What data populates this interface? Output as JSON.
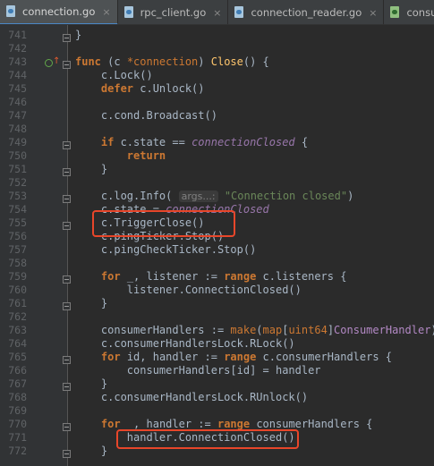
{
  "tabs": [
    {
      "label": "connection.go",
      "active": true,
      "icon": "go-file-icon"
    },
    {
      "label": "rpc_client.go",
      "active": false,
      "icon": "go-file-icon"
    },
    {
      "label": "connection_reader.go",
      "active": false,
      "icon": "go-file-icon"
    },
    {
      "label": "consum",
      "active": false,
      "icon": "go-file-icon"
    }
  ],
  "close_glyph": "×",
  "lines": [
    {
      "n": "741",
      "code": [
        {
          "t": "}"
        }
      ]
    },
    {
      "n": "742",
      "code": []
    },
    {
      "n": "743",
      "code": [
        {
          "t": "func",
          "c": "kw"
        },
        {
          "t": " (c "
        },
        {
          "t": "*connection",
          "c": "kwn"
        },
        {
          "t": ") "
        },
        {
          "t": "Close",
          "c": "fn"
        },
        {
          "t": "() {"
        }
      ]
    },
    {
      "n": "744",
      "code": [
        {
          "t": "    c.Lock()"
        }
      ]
    },
    {
      "n": "745",
      "code": [
        {
          "t": "    "
        },
        {
          "t": "defer",
          "c": "kw"
        },
        {
          "t": " c.Unlock()"
        }
      ]
    },
    {
      "n": "746",
      "code": []
    },
    {
      "n": "747",
      "code": [
        {
          "t": "    c.cond.Broadcast()"
        }
      ]
    },
    {
      "n": "748",
      "code": []
    },
    {
      "n": "749",
      "code": [
        {
          "t": "    "
        },
        {
          "t": "if",
          "c": "kw"
        },
        {
          "t": " c.state == "
        },
        {
          "t": "connectionClosed",
          "c": "it"
        },
        {
          "t": " {"
        }
      ]
    },
    {
      "n": "750",
      "code": [
        {
          "t": "        "
        },
        {
          "t": "return",
          "c": "kw"
        }
      ]
    },
    {
      "n": "751",
      "code": [
        {
          "t": "    }"
        }
      ]
    },
    {
      "n": "752",
      "code": []
    },
    {
      "n": "753",
      "code": [
        {
          "t": "    c.log.Info( "
        },
        {
          "t": "args...:",
          "c": "hint"
        },
        {
          "t": " "
        },
        {
          "t": "\"Connection closed\"",
          "c": "str"
        },
        {
          "t": ")"
        }
      ]
    },
    {
      "n": "754",
      "code": [
        {
          "t": "    c.state = "
        },
        {
          "t": "connectionClosed",
          "c": "it"
        }
      ]
    },
    {
      "n": "755",
      "code": [
        {
          "t": "    c.TriggerClose()"
        }
      ]
    },
    {
      "n": "756",
      "code": [
        {
          "t": "    c.pingTicker.Stop()"
        }
      ]
    },
    {
      "n": "757",
      "code": [
        {
          "t": "    c.pingCheckTicker.Stop()"
        }
      ]
    },
    {
      "n": "758",
      "code": []
    },
    {
      "n": "759",
      "code": [
        {
          "t": "    "
        },
        {
          "t": "for",
          "c": "kw"
        },
        {
          "t": " _, listener := "
        },
        {
          "t": "range",
          "c": "kw"
        },
        {
          "t": " c.listeners {"
        }
      ]
    },
    {
      "n": "760",
      "code": [
        {
          "t": "        listener.ConnectionClosed()"
        }
      ]
    },
    {
      "n": "761",
      "code": [
        {
          "t": "    }"
        }
      ]
    },
    {
      "n": "762",
      "code": []
    },
    {
      "n": "763",
      "code": [
        {
          "t": "    consumerHandlers := "
        },
        {
          "t": "make",
          "c": "kwn"
        },
        {
          "t": "("
        },
        {
          "t": "map",
          "c": "kwn"
        },
        {
          "t": "["
        },
        {
          "t": "uint64",
          "c": "kwn"
        },
        {
          "t": "]"
        },
        {
          "t": "ConsumerHandler",
          "c": "ty"
        },
        {
          "t": ")"
        }
      ]
    },
    {
      "n": "764",
      "code": [
        {
          "t": "    c.consumerHandlersLock.RLock()"
        }
      ]
    },
    {
      "n": "765",
      "code": [
        {
          "t": "    "
        },
        {
          "t": "for",
          "c": "kw"
        },
        {
          "t": " id, handler := "
        },
        {
          "t": "range",
          "c": "kw"
        },
        {
          "t": " c.consumerHandlers {"
        }
      ]
    },
    {
      "n": "766",
      "code": [
        {
          "t": "        consumerHandlers[id] = handler"
        }
      ]
    },
    {
      "n": "767",
      "code": [
        {
          "t": "    }"
        }
      ]
    },
    {
      "n": "768",
      "code": [
        {
          "t": "    c.consumerHandlersLock.RUnlock()"
        }
      ]
    },
    {
      "n": "769",
      "code": []
    },
    {
      "n": "770",
      "code": [
        {
          "t": "    "
        },
        {
          "t": "for",
          "c": "kw"
        },
        {
          "t": " _, handler := "
        },
        {
          "t": "range",
          "c": "kw"
        },
        {
          "t": " consumerHandlers {"
        }
      ]
    },
    {
      "n": "771",
      "code": [
        {
          "t": "        handler.ConnectionClosed()"
        }
      ]
    },
    {
      "n": "772",
      "code": [
        {
          "t": "    }"
        }
      ]
    }
  ]
}
